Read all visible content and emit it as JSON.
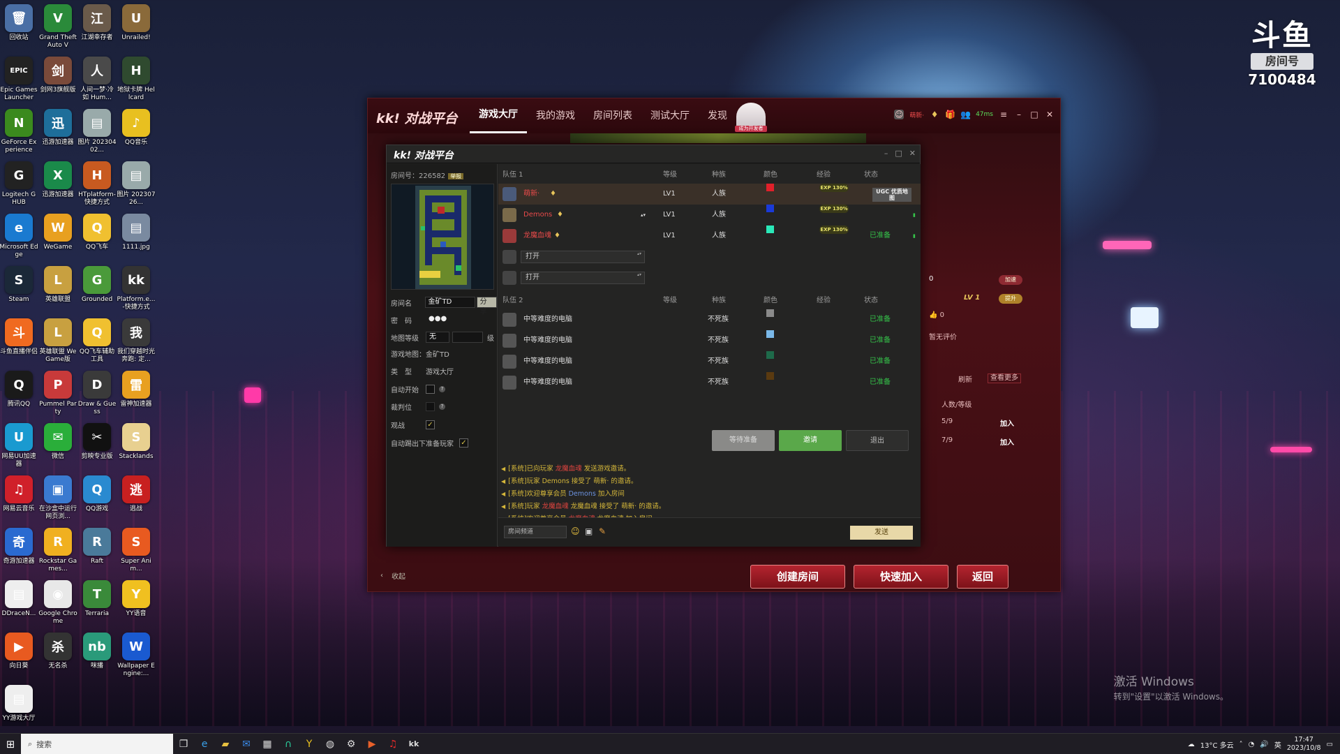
{
  "desktop": {
    "icons": [
      {
        "label": "回收站",
        "glyph": "🗑",
        "color": "#4a6fa5"
      },
      {
        "label": "Grand Theft Auto V",
        "glyph": "V",
        "color": "#2a8a3a"
      },
      {
        "label": "江湖幸存者",
        "glyph": "江",
        "color": "#6a5a4a"
      },
      {
        "label": "Unrailed!",
        "glyph": "U",
        "color": "#8a6a3a"
      },
      {
        "label": "Epic Games Launcher",
        "glyph": "EPIC",
        "color": "#222"
      },
      {
        "label": "剑网3旗舰版",
        "glyph": "剑",
        "color": "#7a4a3a"
      },
      {
        "label": "人间一梦·冷如 Hum...",
        "glyph": "人",
        "color": "#4a4a4a"
      },
      {
        "label": "地狱卡牌 Hellcard",
        "glyph": "H",
        "color": "#2f4a2f"
      },
      {
        "label": "GeForce Experience",
        "glyph": "N",
        "color": "#3b8a1e"
      },
      {
        "label": "迅游加速器",
        "glyph": "迅",
        "color": "#1e6e9a"
      },
      {
        "label": "图片 20230402...",
        "glyph": "▤",
        "color": "#9aa"
      },
      {
        "label": "QQ音乐",
        "glyph": "♪",
        "color": "#e8c020"
      },
      {
        "label": "Logitech G HUB",
        "glyph": "G",
        "color": "#222"
      },
      {
        "label": "迅游加速器",
        "glyph": "X",
        "color": "#1a8a4a"
      },
      {
        "label": "HTplatform-快捷方式",
        "glyph": "H",
        "color": "#c85a20"
      },
      {
        "label": "图片 20230726...",
        "glyph": "▤",
        "color": "#9aa"
      },
      {
        "label": "Microsoft Edge",
        "glyph": "e",
        "color": "#1a7ad0"
      },
      {
        "label": "WeGame",
        "glyph": "W",
        "color": "#e8a020"
      },
      {
        "label": "QQ飞车",
        "glyph": "Q",
        "color": "#f0c030"
      },
      {
        "label": "1111.jpg",
        "glyph": "▤",
        "color": "#7a8aa0"
      },
      {
        "label": "Steam",
        "glyph": "S",
        "color": "#1b2838"
      },
      {
        "label": "英雄联盟",
        "glyph": "L",
        "color": "#c8a040"
      },
      {
        "label": "Grounded",
        "glyph": "G",
        "color": "#4a9a3a"
      },
      {
        "label": "Platform.e...-快捷方式",
        "glyph": "kk",
        "color": "#333"
      },
      {
        "label": "斗鱼直播伴侣",
        "glyph": "斗",
        "color": "#f06a20"
      },
      {
        "label": "英雄联盟 WeGame版",
        "glyph": "L",
        "color": "#c8a040"
      },
      {
        "label": "QQ飞车辅助工具",
        "glyph": "Q",
        "color": "#f0c030"
      },
      {
        "label": "我们穿越时光 奔跑: 定...",
        "glyph": "我",
        "color": "#3a3a3a"
      },
      {
        "label": "腾讯QQ",
        "glyph": "Q",
        "color": "#1a1a1a"
      },
      {
        "label": "Pummel Party",
        "glyph": "P",
        "color": "#c83a3a"
      },
      {
        "label": "Draw & Guess",
        "glyph": "D",
        "color": "#3a3a3a"
      },
      {
        "label": "雷神加速器",
        "glyph": "雷",
        "color": "#e8a020"
      },
      {
        "label": "网易UU加速器",
        "glyph": "U",
        "color": "#1a9ad0"
      },
      {
        "label": "微信",
        "glyph": "✉",
        "color": "#2aae3a"
      },
      {
        "label": "剪映专业版",
        "glyph": "✂",
        "color": "#111"
      },
      {
        "label": "Stacklands",
        "glyph": "S",
        "color": "#e8d090"
      },
      {
        "label": "网易云音乐",
        "glyph": "♫",
        "color": "#d0202a"
      },
      {
        "label": "在沙盒中运行网页浏...",
        "glyph": "▣",
        "color": "#3a7ad0"
      },
      {
        "label": "QQ游戏",
        "glyph": "Q",
        "color": "#2a8ad0"
      },
      {
        "label": "逃战",
        "glyph": "逃",
        "color": "#c82020"
      },
      {
        "label": "奇游加速器",
        "glyph": "奇",
        "color": "#2a6ad0"
      },
      {
        "label": "Rockstar Games...",
        "glyph": "R",
        "color": "#f0b020"
      },
      {
        "label": "Raft",
        "glyph": "R",
        "color": "#4a7a9a"
      },
      {
        "label": "Super Anim...",
        "glyph": "S",
        "color": "#e85a20"
      },
      {
        "label": "DDraceN...",
        "glyph": "▤",
        "color": "#eee"
      },
      {
        "label": "Google Chrome",
        "glyph": "◉",
        "color": "#e8e8e8"
      },
      {
        "label": "Terraria",
        "glyph": "T",
        "color": "#3a8a3a"
      },
      {
        "label": "YY语音",
        "glyph": "Y",
        "color": "#f0c020"
      },
      {
        "label": "向日葵",
        "glyph": "▶",
        "color": "#e85a20"
      },
      {
        "label": "无名杀",
        "glyph": "杀",
        "color": "#333"
      },
      {
        "label": "咪播",
        "glyph": "nb",
        "color": "#2a9a7a"
      },
      {
        "label": "Wallpaper Engine:...",
        "glyph": "W",
        "color": "#1a5ad0"
      },
      {
        "label": "YY游戏大厅",
        "glyph": "▤",
        "color": "#eee"
      }
    ]
  },
  "watermark": {
    "logo": "斗鱼",
    "room_label": "房间号",
    "room_number": "7100484"
  },
  "activate": {
    "line1": "激活 Windows",
    "line2": "转到\"设置\"以激活 Windows。"
  },
  "kk": {
    "logo_kk": "kk!",
    "logo_text": "对战平台",
    "tabs": [
      "游戏大厅",
      "我的游戏",
      "房间列表",
      "测试大厅",
      "发现"
    ],
    "avatar_tag": "成为开发者",
    "user": "萌新·",
    "ping": "47ms",
    "right": {
      "score": "0",
      "btn1": "加速",
      "level": "LV 1",
      "btn2": "提升",
      "likes": "0",
      "no_rating": "暂无评价",
      "refresh": "刷新",
      "more": "查看更多",
      "col_people": "人数/等级",
      "rows": [
        {
          "count": "5/9",
          "join": "加入"
        },
        {
          "count": "7/9",
          "join": "加入"
        }
      ]
    },
    "collapse": "收起",
    "bottom_buttons": [
      "创建房间",
      "快速加入",
      "返回"
    ]
  },
  "room": {
    "logo_kk": "kk!",
    "logo_text": "对战平台",
    "room_id_label": "房间号：226582",
    "room_id_tag": "举报",
    "fields": {
      "name_label": "房间名",
      "name_value": "金矿TD",
      "share": "分享",
      "pwd_label": "密　码",
      "pwd_value": "●●●",
      "maplvl_label": "地图等级",
      "maplvl_value": "无",
      "maplvl_unit": "级",
      "map_label": "游戏地图：",
      "map_value": "金矿TD",
      "type_label": "类　型",
      "type_value": "游戏大厅",
      "autostart_label": "自动开始",
      "referee_label": "裁判位",
      "watch_label": "观战",
      "watch_check": "✓",
      "autokick_label": "自动踢出下准备玩家",
      "autokick_check": "✓"
    },
    "team1": {
      "label": "队伍 1",
      "cols": [
        "等级",
        "种族",
        "颜色",
        "经验",
        "状态"
      ],
      "players": [
        {
          "name": "萌新·",
          "level": "LV1",
          "race": "人族",
          "color": "#e0202a",
          "exp": "EXP 130%",
          "status": ""
        },
        {
          "name": "Demons",
          "level": "LV1",
          "race": "人族",
          "color": "#1a3ad8",
          "exp": "EXP 130%",
          "status": ""
        },
        {
          "name": "龙魔血魂",
          "level": "LV1",
          "race": "人族",
          "color": "#2ae8b8",
          "exp": "EXP 130%",
          "status": "已准备"
        }
      ],
      "open_slots": [
        "打开",
        "打开"
      ]
    },
    "ugc_badge": "UGC 优质地图",
    "team2": {
      "label": "队伍 2",
      "cols": [
        "等级",
        "种族",
        "颜色",
        "经验",
        "状态"
      ],
      "players": [
        {
          "name": "中等难度的电脑",
          "race": "不死族",
          "color": "#8a8a8a",
          "status": "已准备"
        },
        {
          "name": "中等难度的电脑",
          "race": "不死族",
          "color": "#7ab8e8",
          "status": "已准备"
        },
        {
          "name": "中等难度的电脑",
          "race": "不死族",
          "color": "#1e6a4a",
          "status": "已准备"
        },
        {
          "name": "中等难度的电脑",
          "race": "不死族",
          "color": "#5a3a10",
          "status": "已准备"
        }
      ]
    },
    "actions": {
      "wait": "等待准备",
      "invite": "邀请",
      "exit": "退出"
    },
    "chat": [
      {
        "parts": [
          {
            "t": "[系统]已向玩家 "
          },
          {
            "t": "龙魔血魂",
            "c": "red"
          },
          {
            "t": " 发送游戏邀请。"
          }
        ]
      },
      {
        "parts": [
          {
            "t": "[系统]玩家 Demons 接受了 萌新· 的邀请。"
          }
        ]
      },
      {
        "parts": [
          {
            "t": "[系统]欢迎尊享会员 "
          },
          {
            "t": "Demons",
            "c": "blue"
          },
          {
            "t": " 加入房间"
          }
        ]
      },
      {
        "parts": [
          {
            "t": "[系统]玩家 "
          },
          {
            "t": "龙魔血魂",
            "c": "red"
          },
          {
            "t": " 龙魔血魂 接受了 萌新· 的邀请。"
          }
        ]
      },
      {
        "parts": [
          {
            "t": "[系统]欢迎尊享会员 "
          },
          {
            "t": "龙魔血魂",
            "c": "red"
          },
          {
            "t": " 龙魔血魂 加入房间"
          }
        ]
      }
    ],
    "channel": "房间频道",
    "send": "发送"
  },
  "taskbar": {
    "search_placeholder": "搜索",
    "weather": "13°C 多云",
    "ime": "英",
    "time": "17:47",
    "date": "2023/10/8"
  }
}
